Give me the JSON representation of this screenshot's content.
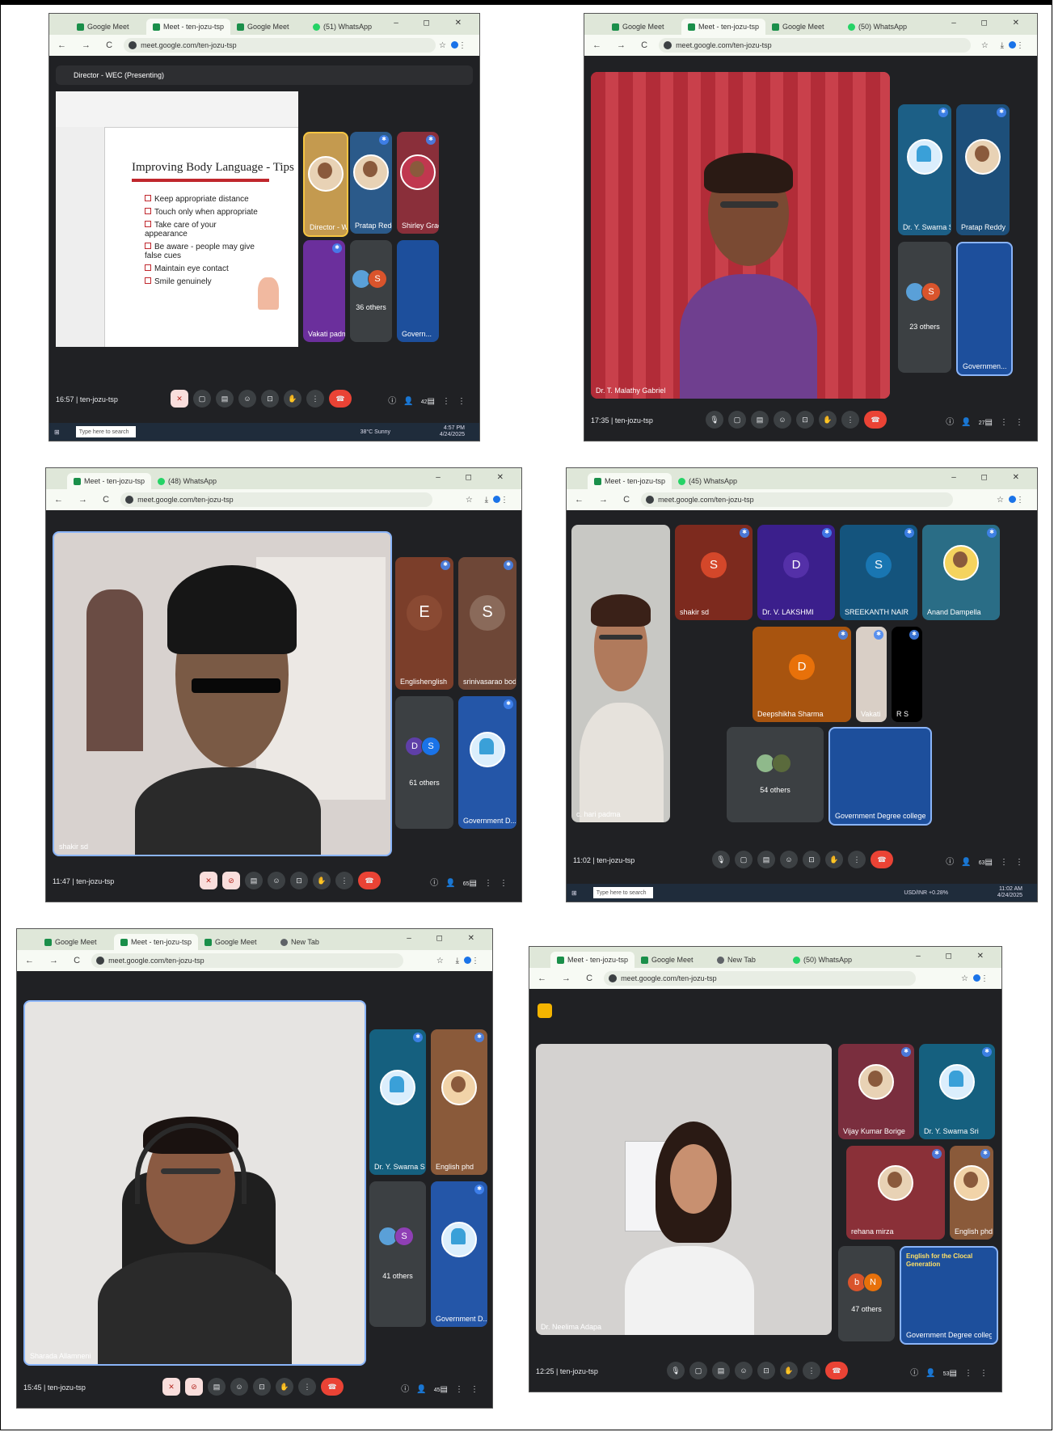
{
  "screenshots": [
    {
      "tabs": [
        "Google Meet",
        "Meet - ten-jozu-tsp",
        "Google Meet",
        "(51) WhatsApp"
      ],
      "url": "meet.google.com/ten-jozu-tsp",
      "presenter_banner": "Director - WEC (Presenting)",
      "slide": {
        "title": "Improving Body Language - Tips",
        "bullets": [
          "Keep appropriate distance",
          "Touch only when appropriate",
          "Take care of your appearance",
          "Be aware - people may give false cues",
          "Maintain eye contact",
          "Smile genuinely"
        ]
      },
      "tiles": [
        "Director - W...",
        "Pratap Reddy",
        "Shirley Grace",
        "Vakati padm...",
        "36 others",
        "Govern..."
      ],
      "others_avatar": "S",
      "meeting_time": "16:57",
      "meeting_code": "ten-jozu-tsp",
      "participant_count": "42",
      "taskbar": {
        "search": "Type here to search",
        "weather": "38°C Sunny",
        "time": "4:57 PM",
        "date": "4/24/2025"
      }
    },
    {
      "tabs": [
        "Google Meet",
        "Meet - ten-jozu-tsp",
        "Google Meet",
        "(50) WhatsApp"
      ],
      "url": "meet.google.com/ten-jozu-tsp",
      "main_speaker": "Dr. T. Malathy Gabriel",
      "tiles": [
        "Dr. Y. Swarna Sri",
        "Pratap Reddy",
        "23 others",
        "Governmen..."
      ],
      "others_avatar": "S",
      "meeting_time": "17:35",
      "meeting_code": "ten-jozu-tsp",
      "participant_count": "27"
    },
    {
      "tabs": [
        "Meet - ten-jozu-tsp",
        "(48) WhatsApp"
      ],
      "url": "meet.google.com/ten-jozu-tsp",
      "main_speaker": "shakir sd",
      "tiles": [
        "Englishenglish",
        "srinivasarao boda",
        "61 others",
        "Government D..."
      ],
      "avatars": [
        "E",
        "S",
        "D",
        "S"
      ],
      "meeting_time": "11:47",
      "meeting_code": "ten-jozu-tsp",
      "participant_count": "65"
    },
    {
      "tabs": [
        "Meet - ten-jozu-tsp",
        "(45) WhatsApp"
      ],
      "url": "meet.google.com/ten-jozu-tsp",
      "main_speaker": "c. hari padma",
      "tiles": [
        "shakir sd",
        "Dr. V. LAKSHMI",
        "SREEKANTH NAIR",
        "Anand Dampella",
        "Deepshikha Sharma",
        "Vakati",
        "R S",
        "54 others",
        "Government Degree college c..."
      ],
      "avatars": [
        "S",
        "D",
        "S",
        "D"
      ],
      "meeting_time": "11:02",
      "meeting_code": "ten-jozu-tsp",
      "participant_count": "63",
      "taskbar": {
        "search": "Type here to search",
        "weather": "USD/INR +0.28%",
        "time": "11:02 AM",
        "date": "4/24/2025"
      }
    },
    {
      "tabs": [
        "Google Meet",
        "Meet - ten-jozu-tsp",
        "Google Meet",
        "New Tab"
      ],
      "url": "meet.google.com/ten-jozu-tsp",
      "main_speaker": "Sharada Allamneni",
      "tiles": [
        "Dr. Y. Swarna Sri",
        "English phd",
        "41 others",
        "Government D..."
      ],
      "others_avatar": "S",
      "meeting_time": "15:45",
      "meeting_code": "ten-jozu-tsp",
      "participant_count": "45"
    },
    {
      "tabs": [
        "Meet - ten-jozu-tsp",
        "Google Meet",
        "New Tab",
        "(50) WhatsApp"
      ],
      "url": "meet.google.com/ten-jozu-tsp",
      "main_speaker": "Dr. Neelima Adapa",
      "tiles": [
        "Vijay Kumar Borige",
        "Dr. Y. Swarna Sri",
        "rehana mirza",
        "English phd",
        "47 others",
        "Government Degree college chaitan..."
      ],
      "avatars": [
        "b",
        "N"
      ],
      "poster_text": "English for the Clocal Generation",
      "meeting_time": "12:25",
      "meeting_code": "ten-jozu-tsp",
      "participant_count": "53"
    }
  ],
  "icons": {
    "mic": "mic-icon",
    "camera": "camera-icon",
    "leave": "leave-call-icon",
    "people": "people-icon",
    "chat": "chat-icon",
    "info": "info-icon",
    "apps": "apps-icon",
    "lock": "lock-icon"
  },
  "colors": {
    "meet_bg": "#202124",
    "leave_red": "#ea4335",
    "chrome_green": "#dfe7d9"
  }
}
